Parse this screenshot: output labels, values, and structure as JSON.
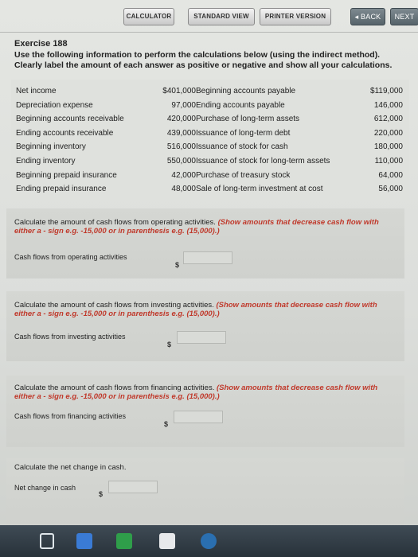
{
  "toolbar": {
    "calculator": "CALCULATOR",
    "standard_view": "STANDARD VIEW",
    "printer_version": "PRINTER VERSION",
    "back": "◂ BACK",
    "next": "NEXT"
  },
  "exercise": {
    "title": "Exercise 188",
    "instructions": "Use the following information to perform the calculations below (using the indirect method). Clearly label the amount of each answer as positive or negative and show all your calculations."
  },
  "data_left": [
    {
      "label": "Net income",
      "value": "$401,000"
    },
    {
      "label": "Depreciation expense",
      "value": "97,000"
    },
    {
      "label": "Beginning accounts receivable",
      "value": "420,000"
    },
    {
      "label": "Ending accounts receivable",
      "value": "439,000"
    },
    {
      "label": "Beginning inventory",
      "value": "516,000"
    },
    {
      "label": "Ending inventory",
      "value": "550,000"
    },
    {
      "label": "Beginning prepaid insurance",
      "value": "42,000"
    },
    {
      "label": "Ending prepaid insurance",
      "value": "48,000"
    }
  ],
  "data_right": [
    {
      "label": "Beginning accounts payable",
      "value": "$119,000"
    },
    {
      "label": "Ending accounts payable",
      "value": "146,000"
    },
    {
      "label": "Purchase of long-term assets",
      "value": "612,000"
    },
    {
      "label": "Issuance of long-term debt",
      "value": "220,000"
    },
    {
      "label": "Issuance of stock for cash",
      "value": "180,000"
    },
    {
      "label": "Issuance of stock for long-term assets",
      "value": "110,000"
    },
    {
      "label": "Purchase of treasury stock",
      "value": "64,000"
    },
    {
      "label": "Sale of long-term investment at cost",
      "value": "56,000"
    }
  ],
  "questions": {
    "operating": {
      "prompt": "Calculate the amount of cash flows from operating activities.",
      "note": "(Show amounts that decrease cash flow with either a - sign e.g. -15,000 or in parenthesis e.g. (15,000).)",
      "answer_label": "Cash flows from operating activities",
      "currency": "$",
      "value": ""
    },
    "investing": {
      "prompt": "Calculate the amount of cash flows from investing activities.",
      "note": "(Show amounts that decrease cash flow with either a - sign e.g. -15,000 or in parenthesis e.g. (15,000).)",
      "answer_label": "Cash flows from investing activities",
      "currency": "$",
      "value": ""
    },
    "financing": {
      "prompt": "Calculate the amount of cash flows from financing activities.",
      "note": "(Show amounts that decrease cash flow with either a - sign e.g. -15,000 or in parenthesis e.g. (15,000).)",
      "answer_label": "Cash flows from financing activities",
      "currency": "$",
      "value": ""
    },
    "net_change": {
      "prompt": "Calculate the net change in cash.",
      "answer_label": "Net change in cash",
      "currency": "$",
      "value": ""
    }
  },
  "colors": {
    "accent_note": "#c0392b",
    "taskbar": "#28323a"
  },
  "taskbar_icons": [
    "file-explorer-icon",
    "windows-icon",
    "store-icon",
    "visual-studio-icon",
    "edge-icon"
  ]
}
